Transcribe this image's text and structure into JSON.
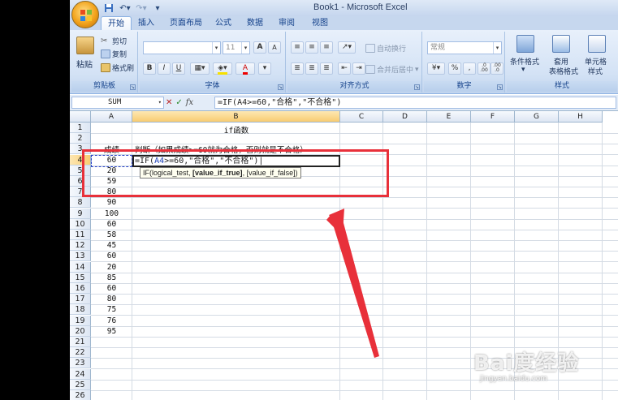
{
  "window": {
    "title": "Book1 - Microsoft Excel"
  },
  "tabs": [
    {
      "label": "开始",
      "active": true
    },
    {
      "label": "插入"
    },
    {
      "label": "页面布局"
    },
    {
      "label": "公式"
    },
    {
      "label": "数据"
    },
    {
      "label": "审阅"
    },
    {
      "label": "视图"
    }
  ],
  "ribbon": {
    "clipboard": {
      "label": "剪贴板",
      "paste": "粘贴",
      "cut": "剪切",
      "copy": "复制",
      "format_painter": "格式刷"
    },
    "font": {
      "label": "字体",
      "font_name": "",
      "font_size": "11",
      "bold": "B",
      "italic": "I",
      "underline": "U",
      "font_color": "A",
      "grow": "A",
      "shrink": "A"
    },
    "alignment": {
      "label": "对齐方式",
      "wrap_text": "自动换行",
      "merge_center": "合并后居中"
    },
    "number": {
      "label": "数字",
      "format": "常规",
      "percent": "%",
      "comma": ",",
      "inc_decimal": ".0 .00",
      "dec_decimal": ".00 .0"
    },
    "styles": {
      "label": "样式",
      "conditional": "条件格式",
      "table_format_1": "套用",
      "table_format_2": "表格格式",
      "cell_styles_1": "单元格",
      "cell_styles_2": "样式"
    }
  },
  "formula_bar": {
    "name_box": "SUM",
    "fx": "fx",
    "formula": "=IF(A4>=60,\"合格\",\"不合格\")"
  },
  "columns": [
    "A",
    "B",
    "C",
    "D",
    "E",
    "F",
    "G",
    "H"
  ],
  "rows": [
    "1",
    "2",
    "3",
    "4",
    "5",
    "6",
    "7",
    "8",
    "9",
    "10",
    "11",
    "12",
    "13",
    "14",
    "15",
    "16",
    "17",
    "18",
    "19",
    "20",
    "21",
    "22",
    "23",
    "24",
    "25",
    "26"
  ],
  "cells": {
    "b1": "if函数",
    "a3": "成绩",
    "b3": "判断（如果成绩>=60就为合格，否则就是不合格）",
    "scores": [
      "60",
      "20",
      "59",
      "80",
      "90",
      "100",
      "60",
      "58",
      "45",
      "60",
      "20",
      "85",
      "60",
      "80",
      "75",
      "76",
      "95"
    ]
  },
  "edit": {
    "prefix": "=IF(",
    "ref": "A4",
    "suffix": ">=60,\"合格\",\"不合格\")"
  },
  "tooltip": {
    "fn": "IF(logical_test, ",
    "current": "[value_if_true]",
    "rest": ", [value_if_false])"
  },
  "watermark": {
    "brand": "Bai度经验",
    "url": "jingyan.baidu.com"
  },
  "colors": {
    "highlight": "#e8303a",
    "selection": "#f8cc72",
    "ref": "#1a3fb5"
  }
}
